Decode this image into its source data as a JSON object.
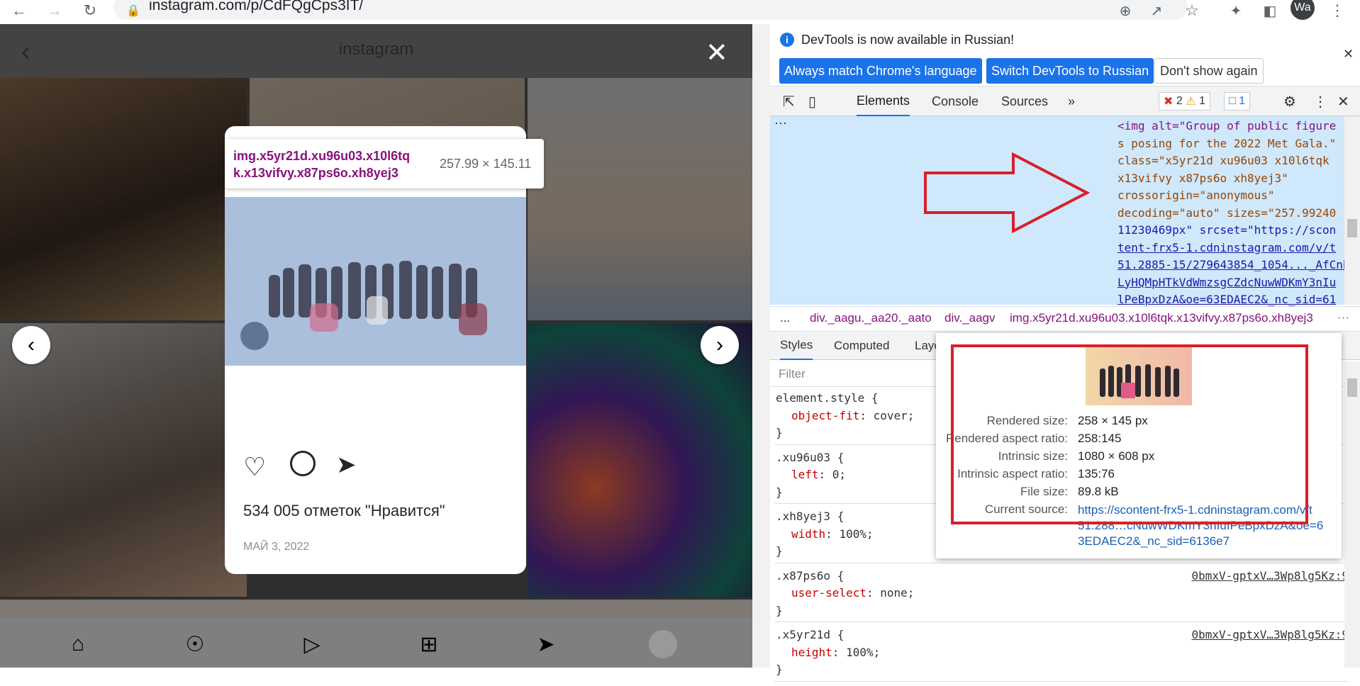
{
  "browser": {
    "url": "instagram.com/p/CdFQgCps3IT/",
    "profile_initials": "Wa"
  },
  "instagram": {
    "header_title": "instagram",
    "tooltip": {
      "selector": "img.x5yr21d.xu96u03.x10l6tqk.x13vifvy.x87ps6o.xh8yej3",
      "selector_line1": "img.x5yr21d.xu96u03.x10l6tq",
      "selector_line2": "k.x13vifvy.x87ps6o.xh8yej3",
      "size": "257.99 × 145.11"
    },
    "likes": "534 005 отметок \"Нравится\"",
    "date": "МАЙ 3, 2022"
  },
  "devtools": {
    "info_text": "DevTools is now available in Russian!",
    "btn_match": "Always match Chrome's language",
    "btn_switch": "Switch DevTools to Russian",
    "btn_dont": "Don't show again",
    "tabs": [
      "Elements",
      "Console",
      "Sources"
    ],
    "errors": "2",
    "warnings": "1",
    "messages": "1",
    "dom_lines": [
      "<img alt=\"Group of public figure",
      "s posing for the 2022 Met Gala.\"",
      "class=\"x5yr21d xu96u03 x10l6tqk",
      "x13vifvy x87ps6o xh8yej3\"",
      "crossorigin=\"anonymous\"",
      "decoding=\"auto\" sizes=\"257.99240",
      "11230469px\" srcset=\"https://scon",
      "tent-frx5-1.cdninstagram.com/v/t",
      "51.2885-15/279643854_1054..._AfCnh",
      "LyHQMpHTkVdWmzsgCZdcNuwWDKmY3nIu",
      "lPeBpxDzA&oe=63EDAEC2&_nc_sid=61"
    ],
    "breadcrumbs": [
      "...",
      "div._aagu._aa20._aato",
      "div._aagv",
      "img.x5yr21d.xu96u03.x10l6tqk.x13vifvy.x87ps6o.xh8yej3"
    ],
    "subtabs": [
      "Styles",
      "Computed",
      "Layo"
    ],
    "filter_placeholder": "Filter",
    "rules": [
      {
        "selector": "element.style {",
        "prop": "object-fit",
        "val": "cover;",
        "src": ""
      },
      {
        "selector": ".xu96u03 {",
        "prop": "left",
        "val": "0;",
        "src": ""
      },
      {
        "selector": ".xh8yej3 {",
        "prop": "width",
        "val": "100%;",
        "src": ""
      },
      {
        "selector": ".x87ps6o {",
        "prop": "user-select",
        "val": "none;",
        "src": "0bmxV-gptxV…3Wp8lg5Kz:9"
      },
      {
        "selector": ".x5yr21d {",
        "prop": "height",
        "val": "100%;",
        "src": "0bmxV-gptxV…3Wp8lg5Kz:9"
      }
    ],
    "popup": {
      "rendered_size_label": "Rendered size:",
      "rendered_size": "258 × 145 px",
      "rendered_ratio_label": "Rendered aspect ratio:",
      "rendered_ratio": "258:145",
      "intrinsic_size_label": "Intrinsic size:",
      "intrinsic_size": "1080 × 608 px",
      "intrinsic_ratio_label": "Intrinsic aspect ratio:",
      "intrinsic_ratio": "135:76",
      "file_size_label": "File size:",
      "file_size": "89.8 kB",
      "source_label": "Current source:",
      "source_line1": "https://scontent-frx5-1.cdninstagram.com/v/t",
      "source_line2": "51.288…cNuwWDKmY3nIuIPeBpxDzA&oe=6",
      "source_line3": "3EDAEC2&_nc_sid=6136e7"
    }
  },
  "colors": {
    "devtools_blue": "#1a73e8",
    "annotation_red": "#d8202a",
    "selection_blue": "#cfe8fc"
  }
}
